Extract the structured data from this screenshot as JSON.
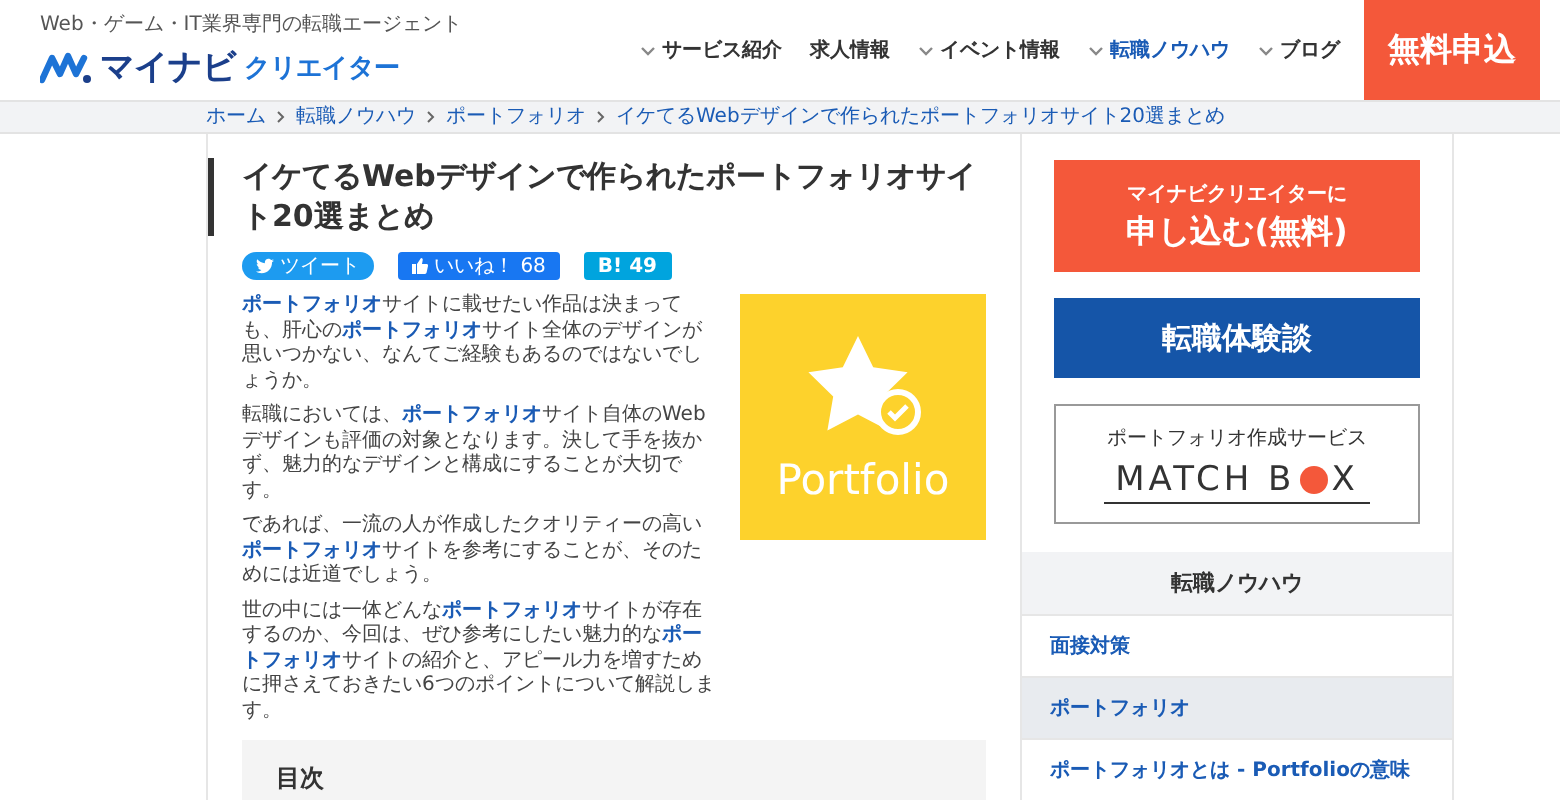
{
  "header": {
    "tagline": "Web・ゲーム・IT業界専門の転職エージェント",
    "logo": {
      "brand": "マイナビ",
      "sub": "クリエイター"
    },
    "nav": [
      {
        "label": "サービス紹介",
        "has_menu": true,
        "selected": false
      },
      {
        "label": "求人情報",
        "has_menu": false,
        "selected": false
      },
      {
        "label": "イベント情報",
        "has_menu": true,
        "selected": false
      },
      {
        "label": "転職ノウハウ",
        "has_menu": true,
        "selected": true
      },
      {
        "label": "ブログ",
        "has_menu": true,
        "selected": false
      }
    ],
    "cta": "無料申込"
  },
  "breadcrumb": [
    "ホーム",
    "転職ノウハウ",
    "ポートフォリオ",
    "イケてるWebデザインで作られたポートフォリオサイト20選まとめ"
  ],
  "article": {
    "title": "イケてるWebデザインで作られたポートフォリオサイト20選まとめ",
    "share": [
      {
        "kind": "tweet",
        "label": "ツイート"
      },
      {
        "kind": "like",
        "label": "いいね！",
        "count": "68"
      },
      {
        "kind": "hatena",
        "label": "B!",
        "count": "49"
      }
    ],
    "paragraphs": [
      "**ポートフォリオ**サイトに載せたい作品は決まっても、肝心の**ポートフォリオ**サイト全体のデザインが思いつかない、なんてご経験もあるのではないでしょうか。",
      "転職においては、**ポートフォリオ**サイト自体のWebデザインも評価の対象となります。決して手を抜かず、魅力的なデザインと構成にすることが大切です。",
      "であれば、一流の人が作成したクオリティーの高い**ポートフォリオ**サイトを参考にすることが、そのためには近道でしょう。",
      "世の中には一体どんな**ポートフォリオ**サイトが存在するのか、今回は、ぜひ参考にしたい魅力的な**ポートフォリオ**サイトの紹介と、アピール力を増すために押さえておきたい6つのポイントについて解説します。"
    ],
    "image_caption": "Portfolio",
    "toc": {
      "title": "目次"
    }
  },
  "sidebar": {
    "banners": [
      {
        "kind": "apply",
        "line1": "マイナビクリエイターに",
        "line2": "申し込む(無料)"
      },
      {
        "kind": "story",
        "label": "転職体験談"
      },
      {
        "kind": "matchbox",
        "caption": "ポートフォリオ作成サービス",
        "logo_parts": [
          "MATCH B",
          "X"
        ]
      }
    ],
    "section": {
      "title": "転職ノウハウ",
      "items": [
        {
          "label": "面接対策",
          "selected": false
        },
        {
          "label": "ポートフォリオ",
          "selected": true,
          "children": [
            {
              "label": "ポートフォリオとは - Portfolioの意味",
              "selected": false
            }
          ]
        }
      ]
    }
  }
}
